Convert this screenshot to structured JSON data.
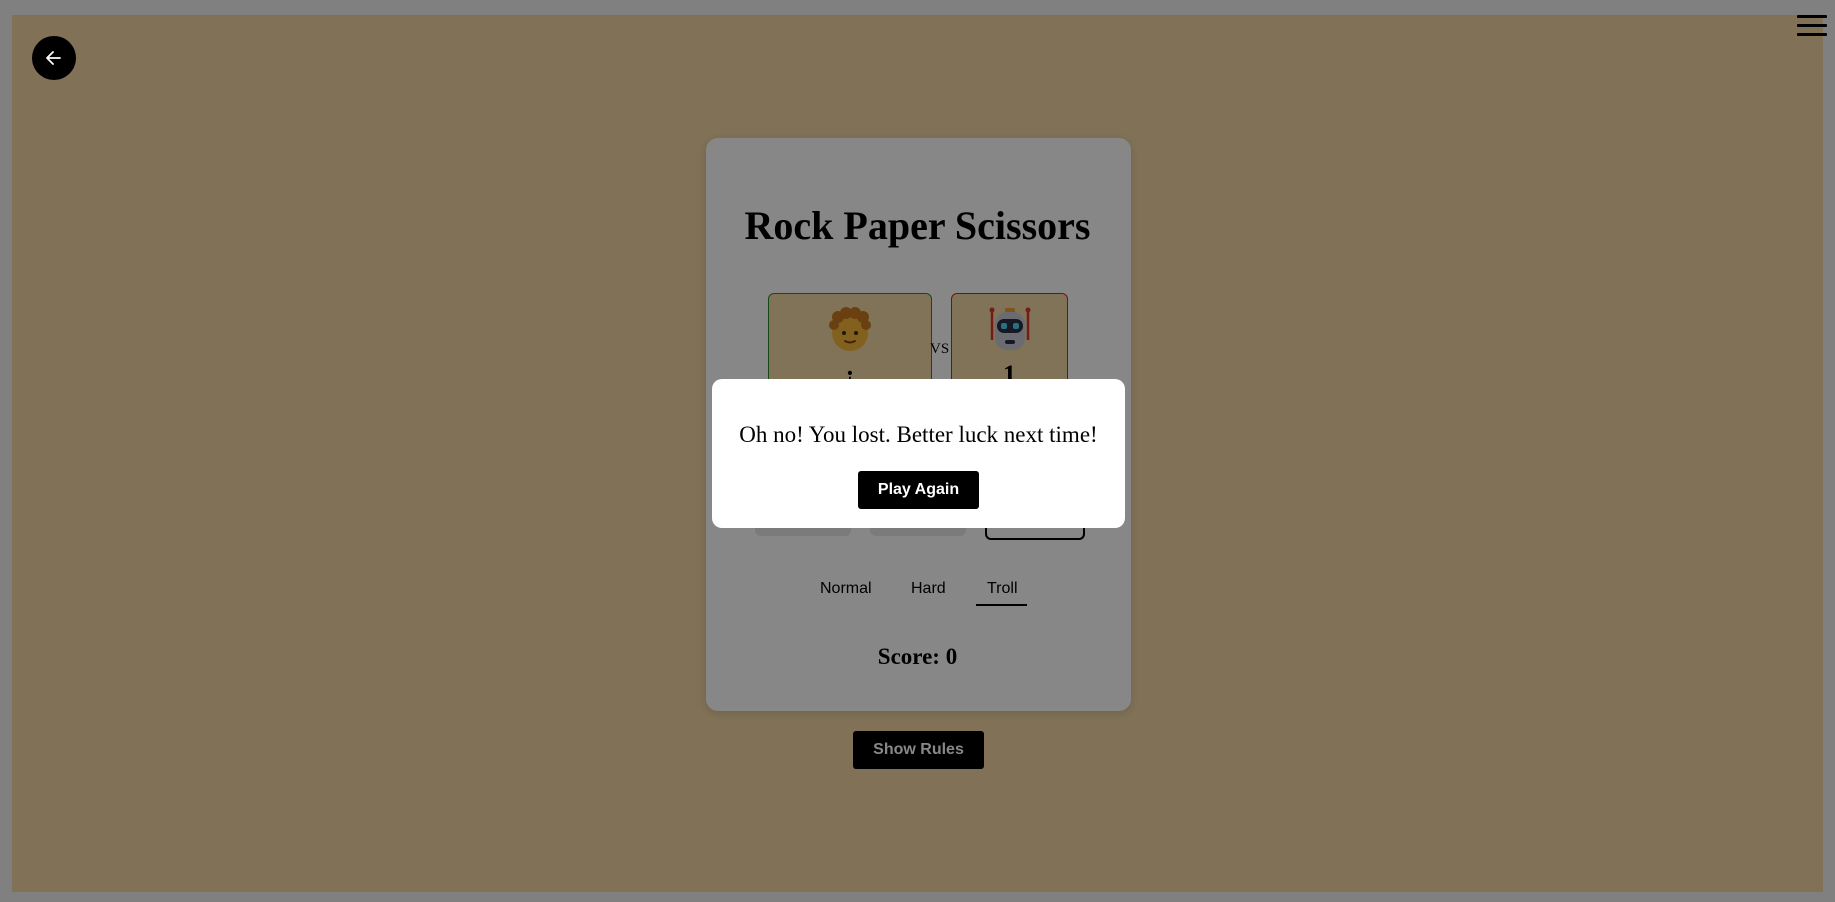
{
  "game": {
    "title": "Rock Paper Scissors",
    "vs_label": "VS",
    "user_choice_glyph": "¡",
    "cpu_choice_glyph": "1",
    "modes": [
      "Normal",
      "Hard",
      "Troll"
    ],
    "active_mode": "Troll",
    "score_text": "Score: 0",
    "show_rules_label": "Show Rules"
  },
  "modal": {
    "message": "Oh no! You lost. Better luck next time!",
    "play_again_label": "Play Again"
  },
  "colors": {
    "page_background": "#f1d6a4",
    "user_border": "#2e8b2e",
    "cpu_border": "#e02020",
    "button": "#000000"
  },
  "icons": {
    "back": "arrow-left-icon",
    "menu": "hamburger-menu-icon",
    "user_avatar": "curly-hair-person-icon",
    "cpu_avatar": "robot-icon"
  }
}
